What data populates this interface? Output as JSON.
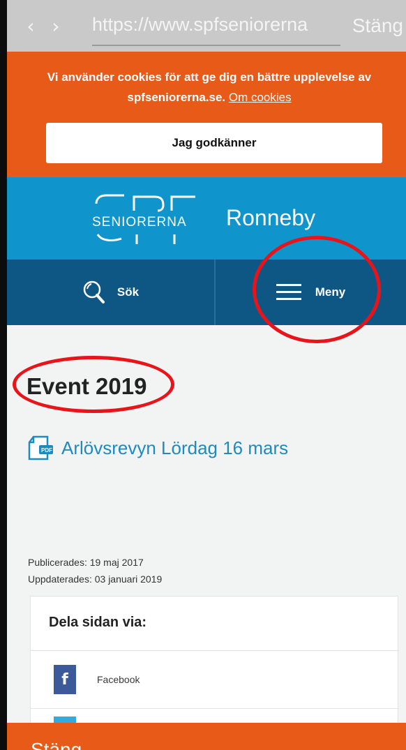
{
  "browser": {
    "back_icon": "chevron-left-icon",
    "forward_icon": "chevron-right-icon",
    "url": "https://www.spfseniorerna",
    "close_label": "Stäng"
  },
  "cookie_banner": {
    "message": "Vi använder cookies för att ge dig en bättre upplevelse av spfseniorerna.se.",
    "link_label": "Om cookies",
    "accept_label": "Jag godkänner"
  },
  "header": {
    "logo_text": "SENIORERNA",
    "region": "Ronneby"
  },
  "nav": {
    "search_label": "Sök",
    "menu_label": "Meny"
  },
  "page": {
    "title": "Event 2019",
    "document_link": "Arlövsrevyn Lördag 16 mars",
    "published": "Publicerades: 19 maj 2017",
    "updated": "Uppdaterades: 03 januari 2019"
  },
  "share": {
    "title": "Dela sidan via:",
    "items": [
      {
        "label": "Facebook",
        "icon": "facebook-icon"
      }
    ]
  },
  "bottom_bar": {
    "label": "Stäng"
  },
  "colors": {
    "brand_blue": "#0f94cb",
    "nav_blue": "#0e5785",
    "cookie_orange": "#e85a18",
    "link_blue": "#1d8bbf",
    "annotation_red": "#e8141a"
  }
}
